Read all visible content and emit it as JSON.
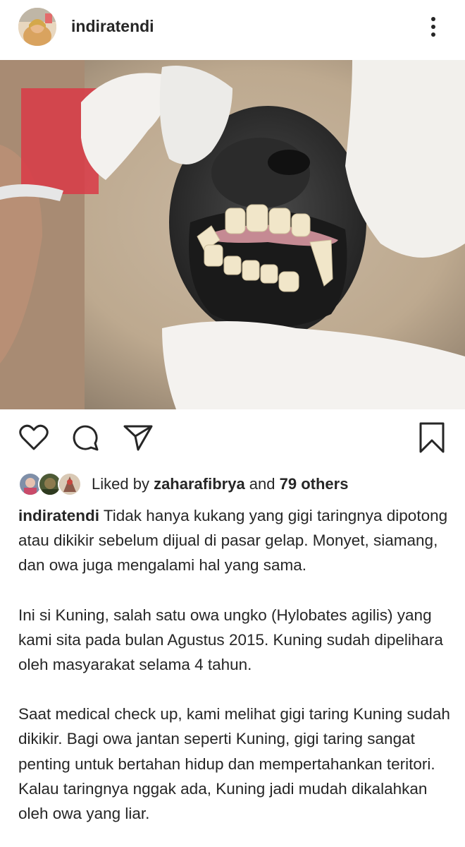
{
  "post": {
    "username": "indiratendi",
    "more_icon": "more-vertical-icon"
  },
  "photo": {
    "description_icon": "photo"
  },
  "actions": {
    "like_icon": "heart-icon",
    "comment_icon": "comment-icon",
    "share_icon": "send-icon",
    "save_icon": "bookmark-icon"
  },
  "likes": {
    "prefix": "Liked by ",
    "user": "zaharafibrya",
    "middle": " and ",
    "count": "79 others"
  },
  "caption": {
    "username": "indiratendi",
    "para1": " Tidak hanya kukang yang gigi taringnya dipotong atau dikikir sebelum dijual di pasar gelap. Monyet, siamang, dan owa juga mengalami hal yang sama.",
    "para2": "Ini si Kuning, salah satu owa ungko (Hylobates agilis) yang kami sita pada bulan Agustus 2015. Kuning sudah dipelihara oleh masyarakat selama 4 tahun.",
    "para3": "Saat medical check up, kami melihat gigi taring Kuning sudah dikikir. Bagi owa jantan seperti Kuning, gigi taring sangat penting untuk bertahan hidup dan mempertahankan teritori. Kalau taringnya nggak ada, Kuning jadi mudah dikalahkan oleh owa yang liar."
  }
}
